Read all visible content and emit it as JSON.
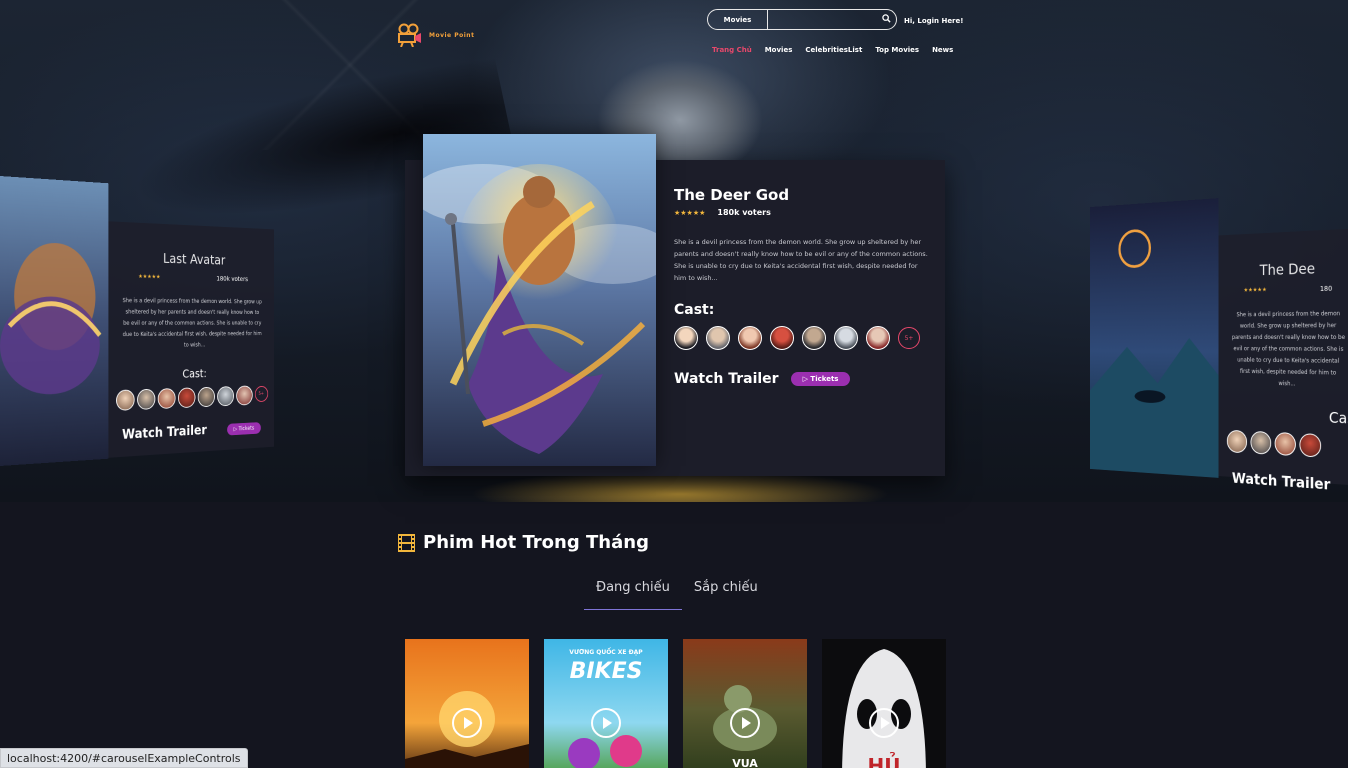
{
  "header": {
    "logo_text": "Movie Point",
    "search": {
      "category": "Movies",
      "placeholder": "",
      "value": ""
    },
    "login": "Hi, Login Here!",
    "nav": [
      "Trang Chủ",
      "Movies",
      "CelebritiesList",
      "Top Movies",
      "News"
    ],
    "nav_active_index": 0
  },
  "featured": {
    "title": "The Deer God",
    "voters": "180k voters",
    "description": "She is a devil princess from the demon world. She grow up sheltered by her parents and doesn't really know how to be evil or any of the common actions. She is unable to cry due to Keita's accidental first wish, despite needed for him to wish...",
    "cast_label": "Cast:",
    "cast_more": "5+",
    "trailer_label": "Watch Trailer",
    "tickets_label": "▷ Tickets"
  },
  "left_card": {
    "title": "Last Avatar",
    "voters": "180k voters",
    "description": "She is a devil princess from the demon world. She grow up sheltered by her parents and doesn't really know how to be evil or any of the common actions. She is unable to cry due to Keita's accidental first wish, despite needed for him to wish...",
    "cast_label": "Cast:",
    "trailer_label": "Watch Trailer",
    "tickets_label": "▷ Tickets"
  },
  "right_card": {
    "title": "The Dee",
    "voters": "180",
    "description": "She is a devil princess from the demon world. She grow up sheltered by her parents and doesn't really know how to be evil or any of the common actions. She is unable to cry due to Keita's accidental first wish, despite needed for him to wish...",
    "cast_label": "Cas",
    "trailer_label": "Watch Trailer"
  },
  "section": {
    "title": "Phim Hot Trong Tháng",
    "tabs": [
      "Đang chiếu",
      "Sắp chiếu"
    ],
    "active_tab": 0
  },
  "movies": [
    {
      "poster_text": ""
    },
    {
      "poster_text": "BIKES",
      "poster_sub": "VƯƠNG QUỐC XE ĐẠP"
    },
    {
      "poster_text": "VUA"
    },
    {
      "poster_text": "HỦ"
    }
  ],
  "status_url": "localhost:4200/#carouselExampleControls",
  "colors": {
    "accent_pink": "#e8486b",
    "ticket_purple": "#9b2fb0",
    "star_gold": "#f2b63c",
    "tab_underline": "#7f74d6"
  },
  "icons": {
    "logo": "film-camera-icon",
    "search": "search-icon",
    "section": "film-strip-icon",
    "play": "play-icon"
  }
}
